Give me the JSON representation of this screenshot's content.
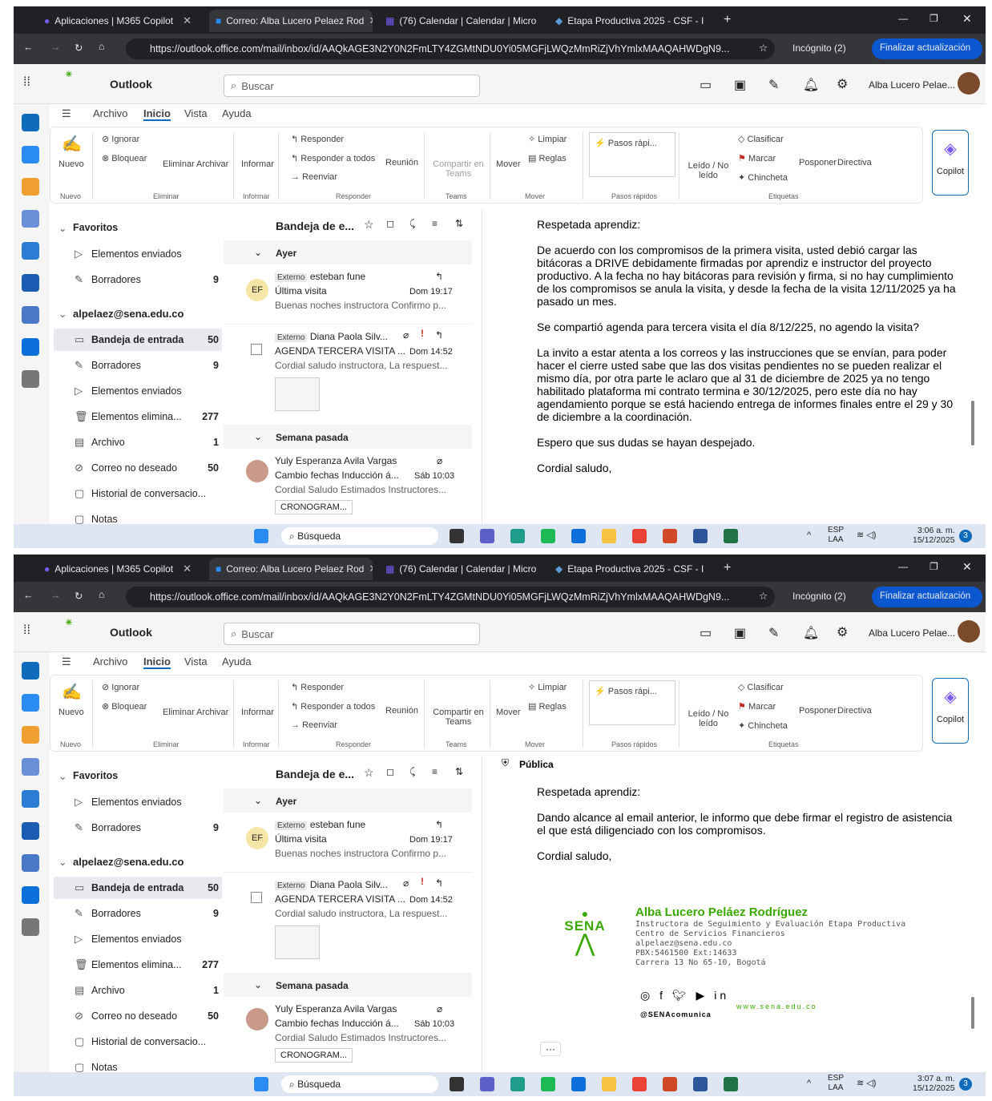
{
  "browser": {
    "tabs": [
      {
        "label": "Aplicaciones | M365 Copilot"
      },
      {
        "label": "Correo: Alba Lucero Pelaez Rod"
      },
      {
        "label": "(76) Calendar | Calendar | Micro"
      },
      {
        "label": "Etapa Productiva 2025 - CSF - I"
      }
    ],
    "url": "https://outlook.office.com/mail/inbox/id/AAQkAGE3N2Y0N2FmLTY4ZGMtNDU0Yi05MGFjLWQzMmRiZjVhYmlxMAAQAHWDgN9...",
    "incognito": "Incógnito (2)",
    "update_button": "Finalizar actualización"
  },
  "outlook": {
    "app_name": "Outlook",
    "search_placeholder": "Buscar",
    "user_name": "Alba Lucero Pelae...",
    "menu": [
      "Archivo",
      "Inicio",
      "Vista",
      "Ayuda"
    ],
    "ribbon": {
      "nuevo": "Nuevo",
      "ignorar": "Ignorar",
      "bloquear": "Bloquear",
      "eliminar": "Eliminar",
      "archivar": "Archivar",
      "informar": "Informar",
      "responder": "Responder",
      "responder_todos": "Responder a todos",
      "reenviar": "Reenviar",
      "reunion": "Reunión",
      "compartir_teams": "Compartir en Teams",
      "mover": "Mover",
      "limpiar": "Limpiar",
      "reglas": "Reglas",
      "pasos_rapidos": "Pasos rápi...",
      "leido": "Leído / No leído",
      "clasificar": "Clasificar",
      "marcar": "Marcar",
      "chincheta": "Chincheta",
      "posponer": "Posponer",
      "directiva": "Directiva",
      "copilot": "Copilot",
      "groups": {
        "nuevo": "Nuevo",
        "eliminar": "Eliminar",
        "informar": "Informar",
        "responder": "Responder",
        "teams": "Teams",
        "mover": "Mover",
        "pasos": "Pasos rápidos",
        "etiquetas": "Etiquetas"
      }
    },
    "folders": {
      "favoritos": "Favoritos",
      "fav_items": [
        {
          "label": "Elementos enviados",
          "count": ""
        },
        {
          "label": "Borradores",
          "count": "9"
        }
      ],
      "account": "alpelaez@sena.edu.co",
      "items": [
        {
          "label": "Bandeja de entrada",
          "count": "50"
        },
        {
          "label": "Borradores",
          "count": "9"
        },
        {
          "label": "Elementos enviados",
          "count": ""
        },
        {
          "label": "Elementos elimina...",
          "count": "277"
        },
        {
          "label": "Archivo",
          "count": "1"
        },
        {
          "label": "Correo no deseado",
          "count": "50"
        },
        {
          "label": "Historial de conversacio...",
          "count": ""
        },
        {
          "label": "Notas",
          "count": ""
        }
      ]
    },
    "list": {
      "header": "Bandeja de e...",
      "group_ayer": "Ayer",
      "group_semana": "Semana pasada",
      "badge_externo": "Externo",
      "messages": [
        {
          "sender": "esteban fune",
          "initials": "EF",
          "subject": "Última visita",
          "time": "Dom 19:17",
          "preview": "Buenas noches instructora Confirmo p..."
        },
        {
          "sender": "Diana Paola Silv...",
          "subject": "AGENDA TERCERA VISITA ...",
          "time": "Dom 14:52",
          "preview": "Cordial saludo instructora, La respuest..."
        },
        {
          "sender": "Yuly Esperanza Avila Vargas",
          "subject": "Cambio fechas Inducción á...",
          "time": "Sáb 10:03",
          "preview": "Cordial Saludo Estimados Instructores...",
          "attachment": "CRONOGRAM..."
        }
      ]
    }
  },
  "email1": {
    "greeting": "Respetada aprendiz:",
    "p1": "De acuerdo con los compromisos de la primera visita, usted debió cargar las bitácoras a DRIVE debidamente firmadas por aprendiz e instructor del proyecto productivo. A la fecha no hay bitácoras para revisión y firma, si no hay cumplimiento de los compromisos se anula la visita, y desde la fecha de la visita 12/11/2025 ya ha pasado un mes.",
    "p2": "Se compartió agenda para tercera visita el día 8/12/225, no agendo la visita?",
    "p3": "La invito a estar atenta a los correos y las instrucciones que se envían, para poder hacer el cierre usted sabe que las dos visitas pendientes no se pueden realizar el mismo día, por otra parte le aclaro que al 31 de diciembre de 2025 ya no tengo habilitado plataforma mi contrato termina e 30/12/2025, pero este día no hay agendamiento porque se está haciendo entrega de informes finales entre el 29 y 30 de diciembre a la coordinación.",
    "p4": "Espero que sus dudas se hayan despejado.",
    "closing": "Cordial saludo,"
  },
  "email2": {
    "label": "Pública",
    "greeting": "Respetada aprendiz:",
    "p1": "Dando alcance al email anterior, le informo que debe firmar el registro de asistencia el que está diligenciado con los compromisos.",
    "closing": "Cordial saludo,",
    "signature": {
      "logo_text": "SENA",
      "name": "Alba Lucero Peláez Rodríguez",
      "role": "Instructora de Seguimiento y Evaluación Etapa Productiva",
      "center": "Centro de Servicios Financieros",
      "email": "alpelaez@sena.edu.co",
      "phone": "PBX:5461500 Ext:14633",
      "address": "Carrera 13 No 65-10, Bogotá",
      "handle": "@SENAcomunica",
      "web": "www.sena.edu.co"
    }
  },
  "taskbar": {
    "search": "Búsqueda",
    "lang": "ESP",
    "lang2": "LAA",
    "time1": "3:06 a. m.",
    "time2": "3:07 a. m.",
    "date": "15/12/2025",
    "notif": "3"
  },
  "colors": {
    "accent": "#0f6cbd",
    "sena_green": "#39a900",
    "chrome_dark": "#202124"
  }
}
